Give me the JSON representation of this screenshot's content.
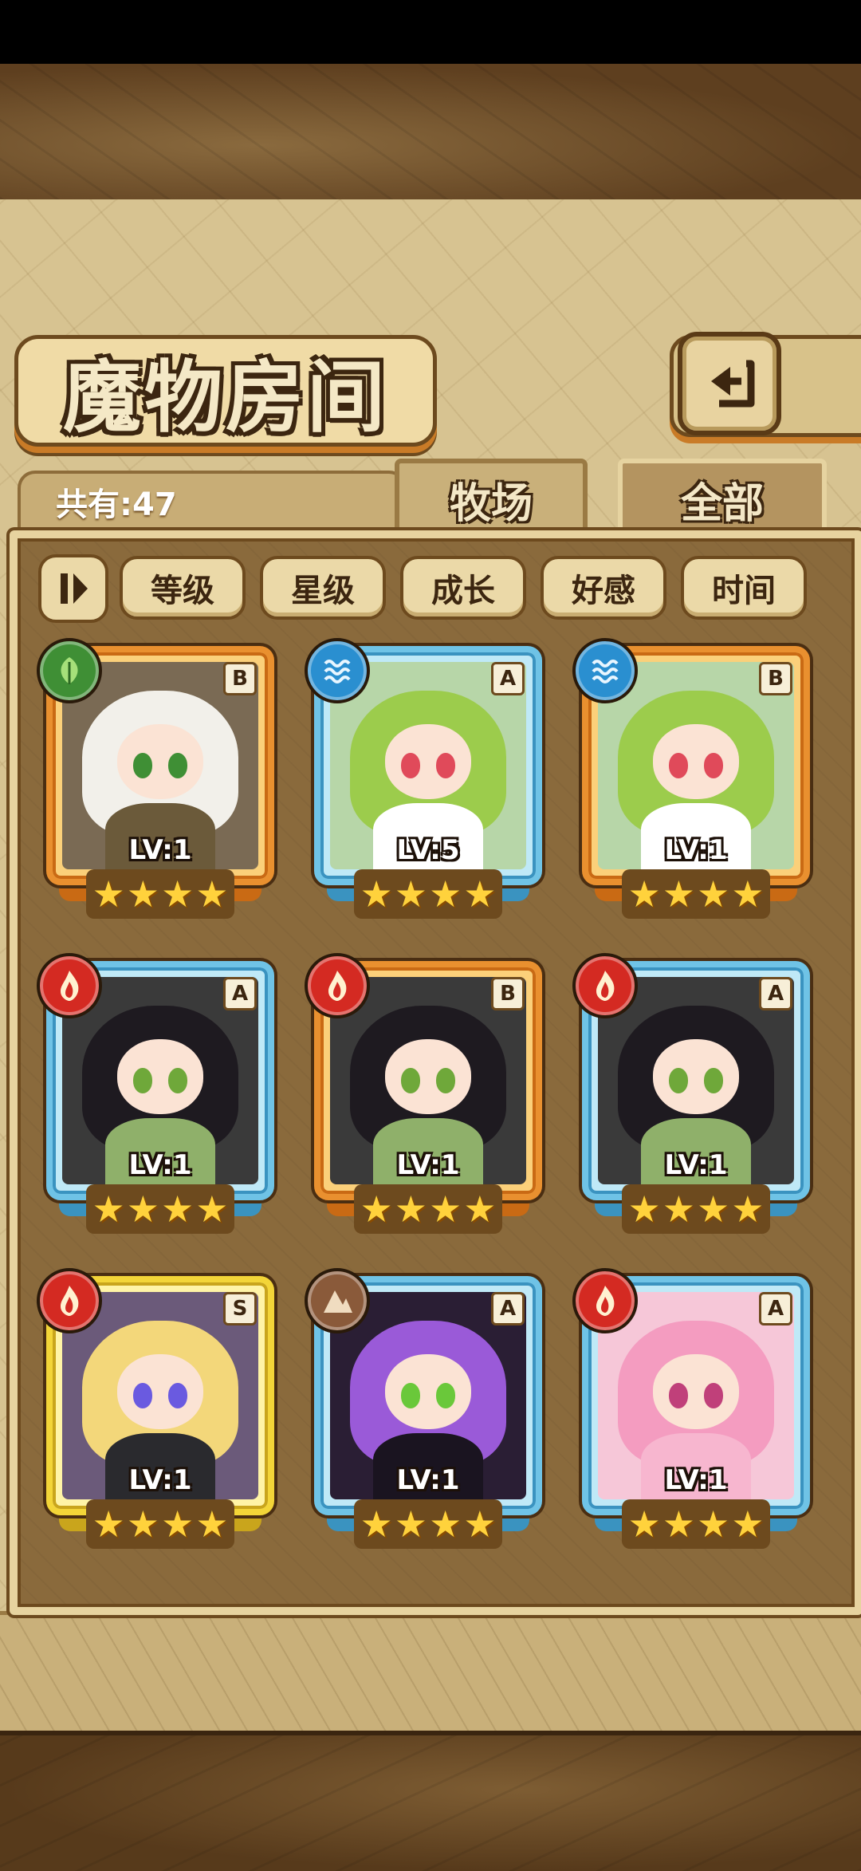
{
  "screen": {
    "title": "魔物房间",
    "count_label": "共有:47",
    "tabs": [
      {
        "label": "牧场",
        "active": false
      },
      {
        "label": "全部",
        "active": true
      }
    ],
    "sort_buttons": [
      "等级",
      "星级",
      "成长",
      "好感",
      "时间"
    ]
  },
  "monsters": [
    {
      "level": "LV:1",
      "grade": "B",
      "element": "leaf-icon",
      "frame": "orange",
      "stars": 4
    },
    {
      "level": "LV:5",
      "grade": "A",
      "element": "water-icon",
      "frame": "blue",
      "stars": 4
    },
    {
      "level": "LV:1",
      "grade": "B",
      "element": "water-icon",
      "frame": "orange",
      "stars": 4
    },
    {
      "level": "LV:1",
      "grade": "A",
      "element": "fire-icon",
      "frame": "blue",
      "stars": 4
    },
    {
      "level": "LV:1",
      "grade": "B",
      "element": "fire-icon",
      "frame": "orange",
      "stars": 4
    },
    {
      "level": "LV:1",
      "grade": "A",
      "element": "fire-icon",
      "frame": "blue",
      "stars": 4
    },
    {
      "level": "LV:1",
      "grade": "S",
      "element": "fire-icon",
      "frame": "gold",
      "stars": 4
    },
    {
      "level": "LV:1",
      "grade": "A",
      "element": "earth-icon",
      "frame": "blue",
      "stars": 4
    },
    {
      "level": "LV:1",
      "grade": "A",
      "element": "fire-icon",
      "frame": "blue",
      "stars": 4
    }
  ],
  "colors": {
    "frame_orange": "#e9902f",
    "frame_blue": "#6fc3e6",
    "frame_gold": "#f3d538",
    "element_leaf": "#3f8f35",
    "element_water": "#2a8fd0",
    "element_fire": "#d42a22",
    "element_earth": "#8a5a3a"
  }
}
